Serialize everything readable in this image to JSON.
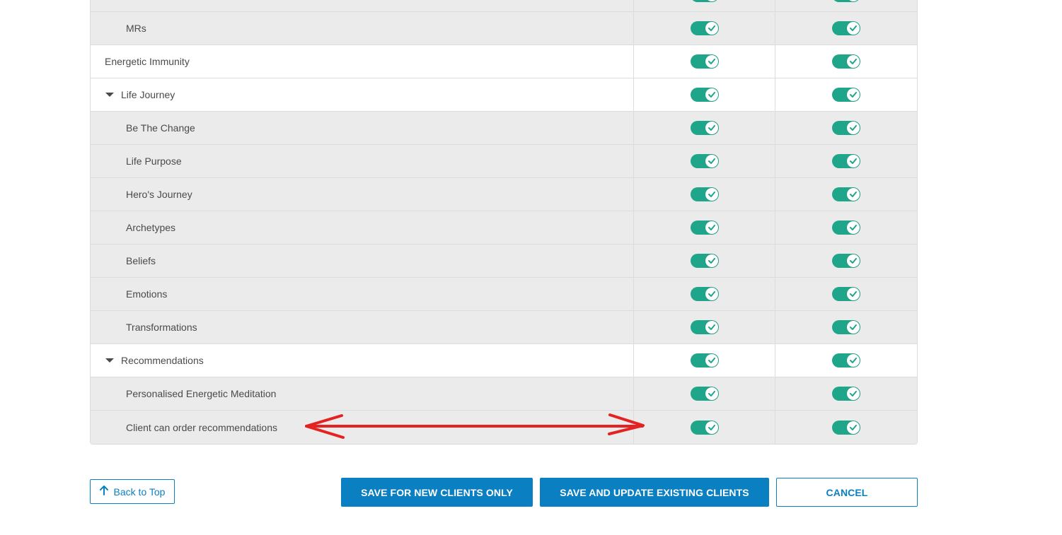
{
  "colors": {
    "toggle_on": "#1fa58a",
    "primary": "#0a7fc2",
    "child_row_bg": "#ebebeb",
    "annotation_arrow": "#e52222"
  },
  "rows": [
    {
      "label": "",
      "type": "child",
      "col1_on": true,
      "col2_on": true
    },
    {
      "label": "MRs",
      "type": "child",
      "col1_on": true,
      "col2_on": true
    },
    {
      "label": "Energetic Immunity",
      "type": "parent",
      "col1_on": true,
      "col2_on": true
    },
    {
      "label": "Life Journey",
      "type": "parent-collapsible",
      "col1_on": true,
      "col2_on": true
    },
    {
      "label": "Be The Change",
      "type": "child",
      "col1_on": true,
      "col2_on": true
    },
    {
      "label": "Life Purpose",
      "type": "child",
      "col1_on": true,
      "col2_on": true
    },
    {
      "label": "Hero's Journey",
      "type": "child",
      "col1_on": true,
      "col2_on": true
    },
    {
      "label": "Archetypes",
      "type": "child",
      "col1_on": true,
      "col2_on": true
    },
    {
      "label": "Beliefs",
      "type": "child",
      "col1_on": true,
      "col2_on": true
    },
    {
      "label": "Emotions",
      "type": "child",
      "col1_on": true,
      "col2_on": true
    },
    {
      "label": "Transformations",
      "type": "child",
      "col1_on": true,
      "col2_on": true
    },
    {
      "label": "Recommendations",
      "type": "parent-collapsible",
      "col1_on": true,
      "col2_on": true
    },
    {
      "label": "Personalised Energetic Meditation",
      "type": "child",
      "col1_on": true,
      "col2_on": true
    },
    {
      "label": "Client can order recommendations",
      "type": "child",
      "col1_on": true,
      "col2_on": true
    }
  ],
  "footer": {
    "back_to_top": "Back to Top",
    "save_new": "SAVE FOR NEW CLIENTS ONLY",
    "save_update": "SAVE AND UPDATE EXISTING CLIENTS",
    "cancel": "CANCEL"
  },
  "icons": {
    "caret": "caret-down-icon",
    "check": "check-icon",
    "arrow_up": "arrow-up-icon",
    "annotation": "double-headed-arrow-annotation"
  }
}
